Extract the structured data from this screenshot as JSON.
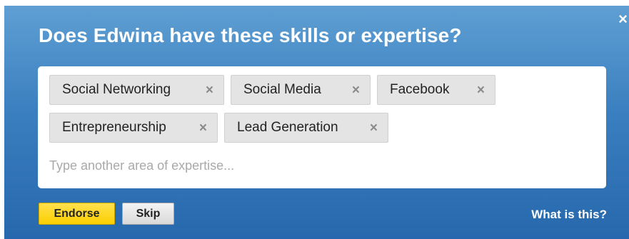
{
  "dialog": {
    "close_icon": "×",
    "title": "Does Edwina have these skills or expertise?",
    "skills": [
      {
        "label": "Social Networking",
        "remove_icon": "×"
      },
      {
        "label": "Social Media",
        "remove_icon": "×"
      },
      {
        "label": "Facebook",
        "remove_icon": "×"
      },
      {
        "label": "Entrepreneurship",
        "remove_icon": "×"
      },
      {
        "label": "Lead Generation",
        "remove_icon": "×"
      }
    ],
    "input": {
      "value": "",
      "placeholder": "Type another area of expertise..."
    },
    "buttons": {
      "endorse": "Endorse",
      "skip": "Skip"
    },
    "help_link": "What is this?"
  },
  "colors": {
    "accent_button": "#fbcf00",
    "dialog_top": "#5f9fd3",
    "dialog_bottom": "#2768ad"
  }
}
